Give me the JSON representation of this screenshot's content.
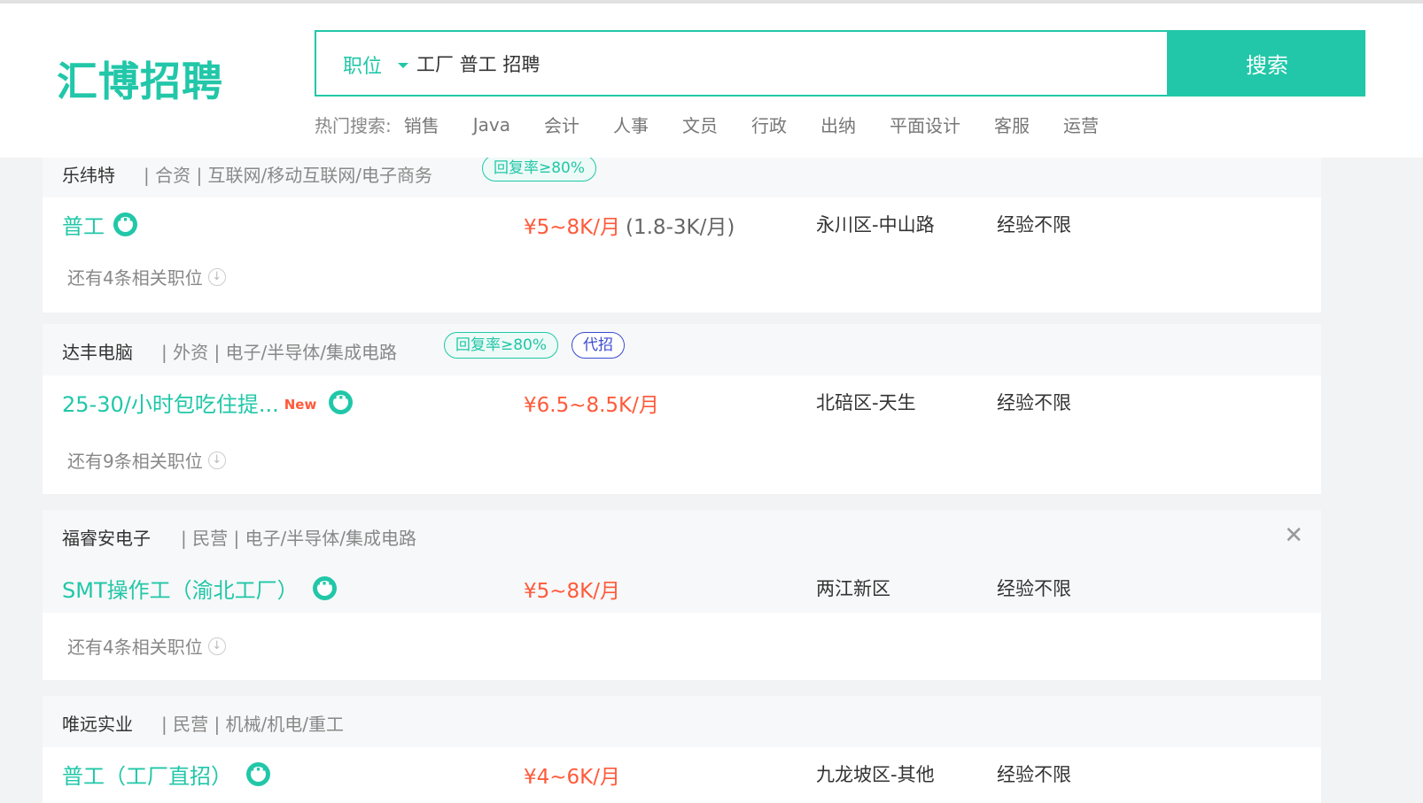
{
  "header": {
    "logo": "汇博招聘",
    "search": {
      "type_label": "职位",
      "query": "工厂 普工 招聘",
      "button_label": "搜索"
    },
    "hot_label": "热门搜索:",
    "hot_items": [
      "销售",
      "Java",
      "会计",
      "人事",
      "文员",
      "行政",
      "出纳",
      "平面设计",
      "客服",
      "运营"
    ]
  },
  "cards": [
    {
      "company": "乐纬特",
      "info": "| 合资 | 互联网/移动互联网/电子商务",
      "tags": [
        "回复率≥80%"
      ],
      "job_title": "普工",
      "salary": "¥5~8K/月",
      "salary_extra": "(1.8-3K/月)",
      "location": "永川区-中山路",
      "experience": "经验不限",
      "more": "还有4条相关职位"
    },
    {
      "company": "达丰电脑",
      "info": "| 外资 | 电子/半导体/集成电路",
      "tags": [
        "回复率≥80%",
        "代招"
      ],
      "job_title": "25-30/小时包吃住提...",
      "new_badge": "New",
      "salary": "¥6.5~8.5K/月",
      "location": "北碚区-天生",
      "experience": "经验不限",
      "more": "还有9条相关职位"
    },
    {
      "company": "福睿安电子",
      "info": "| 民营 | 电子/半导体/集成电路",
      "job_title": "SMT操作工（渝北工厂）",
      "salary": "¥5~8K/月",
      "location": "两江新区",
      "experience": "经验不限",
      "more": "还有4条相关职位",
      "close": "✕"
    },
    {
      "company": "唯远实业",
      "info": "| 民营 | 机械/机电/重工",
      "job_title": "普工（工厂直招）",
      "salary": "¥4~6K/月",
      "location": "九龙坡区-其他",
      "experience": "经验不限"
    }
  ]
}
